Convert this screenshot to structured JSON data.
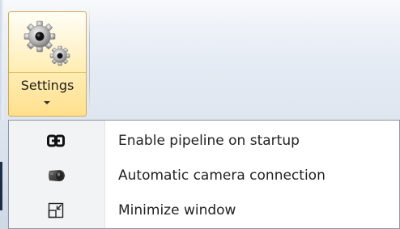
{
  "ribbon": {
    "settings_button": {
      "label": "Settings",
      "icon": "gears-icon",
      "dropdown_icon": "chevron-down-icon"
    }
  },
  "menu": {
    "items": [
      {
        "label": "Enable pipeline on startup",
        "icon": "link-icon"
      },
      {
        "label": "Automatic camera connection",
        "icon": "camera-icon"
      },
      {
        "label": "Minimize window",
        "icon": "minimize-window-icon"
      }
    ]
  }
}
